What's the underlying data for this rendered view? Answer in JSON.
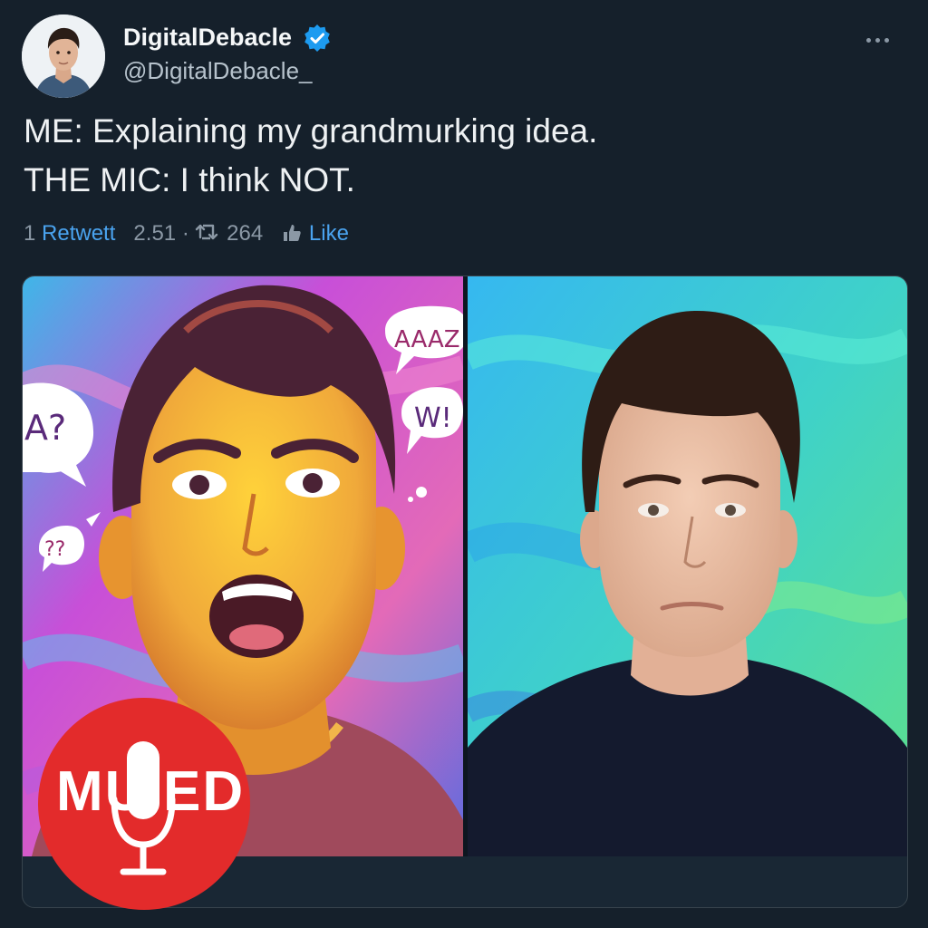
{
  "author": {
    "display_name": "DigitalDebacle",
    "handle": "@DigitalDebacle_",
    "verified": true,
    "avatar_icon": "user-avatar"
  },
  "tweet": {
    "lines": [
      "ME: Explaining my grandmurking idea.",
      "THE MIC: I think NOT."
    ]
  },
  "stats": {
    "retweet_count": "1",
    "retweet_label": "Retwett",
    "views": "2.51",
    "separator": "·",
    "retweet_icon": "retweet-icon",
    "second_count": "264",
    "like_icon": "like-icon",
    "like_label": "Like"
  },
  "media": {
    "left_bubbles": [
      "AAAZ",
      "W!",
      "A?",
      "??"
    ],
    "badge": {
      "left_letters": "MU",
      "right_letters": "ED",
      "mic_icon": "microphone-icon",
      "color": "#e32b2b"
    }
  },
  "colors": {
    "background": "#15202b",
    "accent": "#4aa3ef",
    "muted_text": "#8b98a5"
  }
}
